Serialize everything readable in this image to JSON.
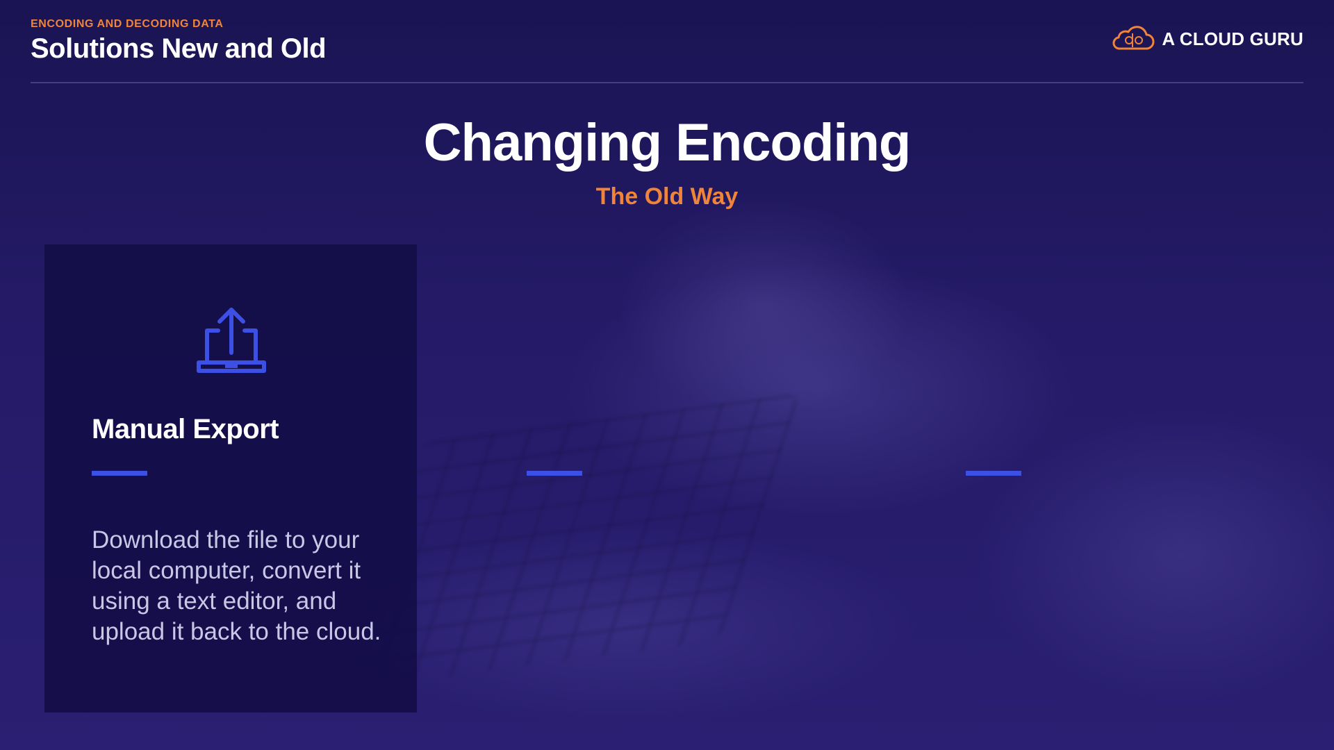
{
  "header": {
    "eyebrow": "ENCODING AND DECODING DATA",
    "title": "Solutions New and Old"
  },
  "brand": {
    "name": "A CLOUD GURU",
    "icon": "cloud-logo-icon",
    "color": "#f0843a"
  },
  "main": {
    "title": "Changing Encoding",
    "subtitle": "The Old Way"
  },
  "card": {
    "icon": "laptop-upload-icon",
    "title": "Manual Export",
    "body": "Download the file to your local computer, convert it using a text editor, and upload it back to the cloud."
  },
  "colors": {
    "accent": "#f0843a",
    "dash": "#3d50e6",
    "background": "#1a1255"
  }
}
